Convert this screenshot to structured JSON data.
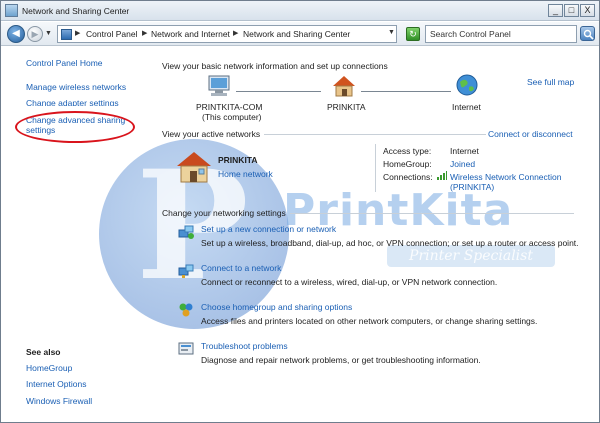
{
  "window": {
    "title": "Network and Sharing Center",
    "minimize_glyph": "_",
    "restore_glyph": "□",
    "close_glyph": "X"
  },
  "address": {
    "crumbs": [
      "Control Panel",
      "Network and Internet",
      "Network and Sharing Center"
    ],
    "search_placeholder": "Search Control Panel"
  },
  "sidebar": {
    "home": "Control Panel Home",
    "manage_wireless": "Manage wireless networks",
    "change_adapter": "Change adapter settings",
    "advanced_sharing": "Change advanced sharing settings",
    "see_also_title": "See also",
    "see_also": [
      "HomeGroup",
      "Internet Options",
      "Windows Firewall"
    ]
  },
  "main": {
    "basic_heading": "View your basic network information and set up connections",
    "see_full_map": "See full map",
    "map_nodes": [
      {
        "label": "PRINTKITA-COM",
        "sublabel": "(This computer)"
      },
      {
        "label": "PRINKITA"
      },
      {
        "label": "Internet"
      }
    ],
    "active_heading": "View your active networks",
    "connect_disconnect": "Connect or disconnect",
    "network": {
      "name": "PRINKITA",
      "type": "Home network",
      "access_type_label": "Access type:",
      "access_type_value": "Internet",
      "homegroup_label": "HomeGroup:",
      "homegroup_value": "Joined",
      "connections_label": "Connections:",
      "connection_value": "Wireless Network Connection",
      "connection_sub": "(PRINKITA)"
    },
    "change_heading": "Change your networking settings",
    "tasks": [
      {
        "title": "Set up a new connection or network",
        "desc": "Set up a wireless, broadband, dial-up, ad hoc, or VPN connection; or set up a router or access point."
      },
      {
        "title": "Connect to a network",
        "desc": "Connect or reconnect to a wireless, wired, dial-up, or VPN network connection."
      },
      {
        "title": "Choose homegroup and sharing options",
        "desc": "Access files and printers located on other network computers, or change sharing settings."
      },
      {
        "title": "Troubleshoot problems",
        "desc": "Diagnose and repair network problems, or get troubleshooting information."
      }
    ]
  },
  "watermark": {
    "letter": "P",
    "brand": "PrintKita",
    "tagline": "Printer Specialist"
  },
  "colors": {
    "link": "#1a5fb4",
    "highlight_oval": "#d9141c"
  }
}
